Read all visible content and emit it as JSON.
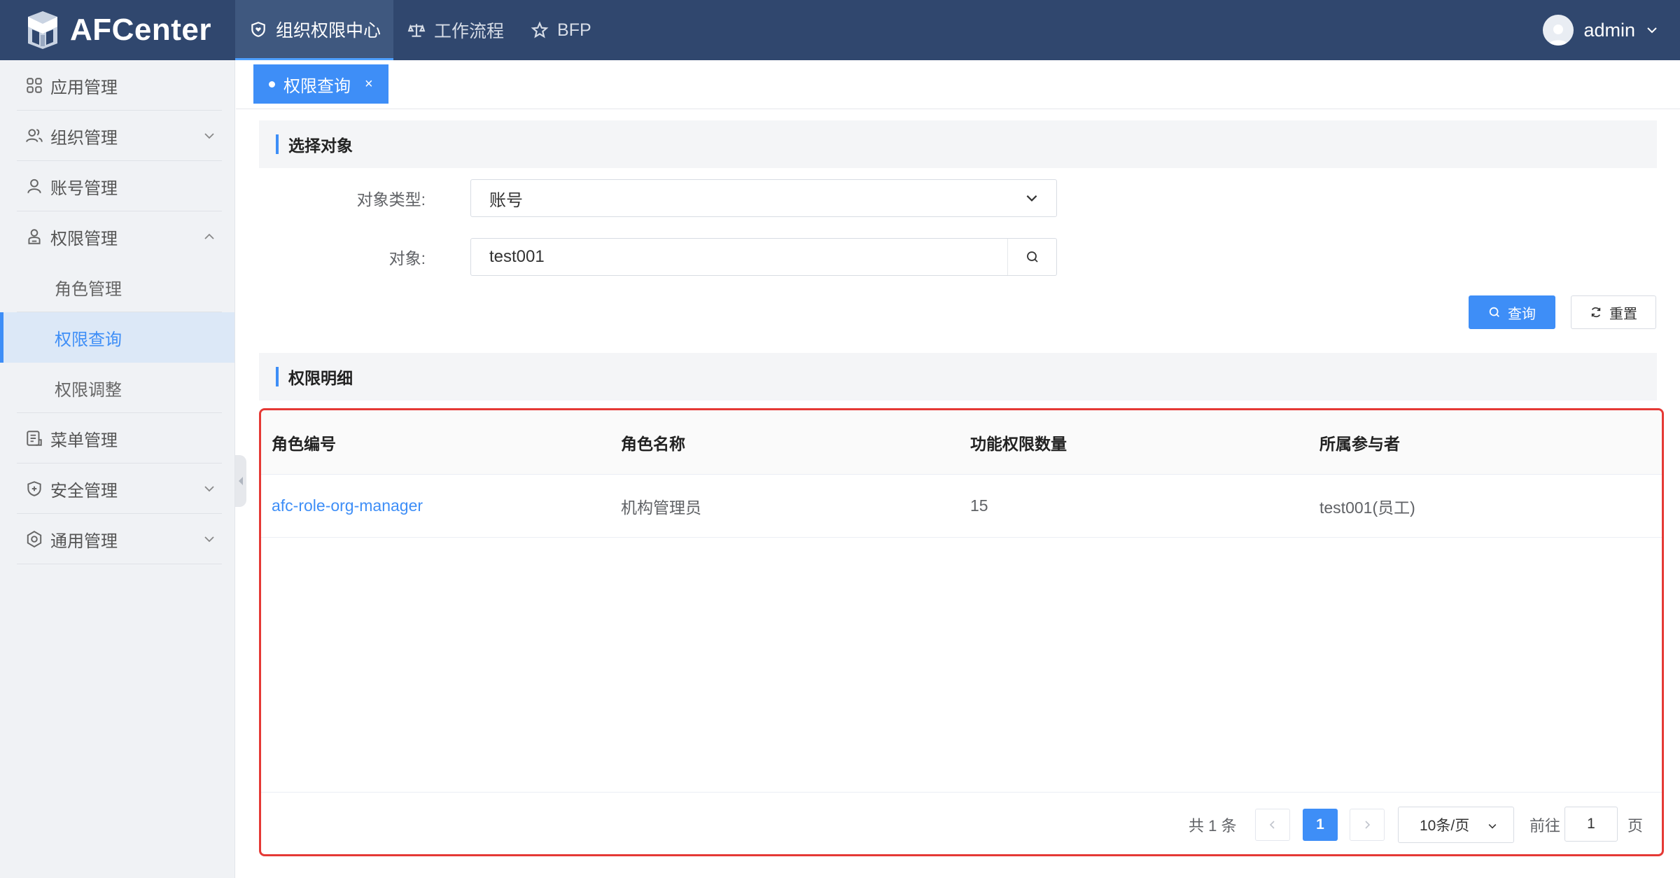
{
  "app": {
    "name": "AFCenter"
  },
  "topnav": [
    {
      "label": "组织权限中心",
      "icon": "shield-heart-icon",
      "active": true
    },
    {
      "label": "工作流程",
      "icon": "scale-icon",
      "active": false
    },
    {
      "label": "BFP",
      "icon": "star-icon",
      "active": false
    }
  ],
  "user": {
    "name": "admin"
  },
  "sidebar": {
    "items": [
      {
        "label": "应用管理",
        "icon": "grid-icon"
      },
      {
        "label": "组织管理",
        "icon": "users-icon",
        "expandable": true
      },
      {
        "label": "账号管理",
        "icon": "user-icon"
      },
      {
        "label": "权限管理",
        "icon": "lock-user-icon",
        "expanded": true,
        "children": [
          {
            "label": "角色管理"
          },
          {
            "label": "权限查询",
            "active": true
          },
          {
            "label": "权限调整"
          }
        ]
      },
      {
        "label": "菜单管理",
        "icon": "menu-doc-icon"
      },
      {
        "label": "安全管理",
        "icon": "shield-plus-icon",
        "expandable": true
      },
      {
        "label": "通用管理",
        "icon": "settings-icon",
        "expandable": true
      }
    ]
  },
  "tabs": [
    {
      "label": "权限查询",
      "close": "×"
    }
  ],
  "select_section": {
    "title": "选择对象",
    "type_label": "对象类型:",
    "type_value": "账号",
    "object_label": "对象:",
    "object_value": "test001",
    "query_button": "查询",
    "reset_button": "重置"
  },
  "detail_section": {
    "title": "权限明细",
    "columns": [
      "角色编号",
      "角色名称",
      "功能权限数量",
      "所属参与者"
    ],
    "rows": [
      [
        "afc-role-org-manager",
        "机构管理员",
        "15",
        "test001(员工)"
      ]
    ]
  },
  "pagination": {
    "total_text": "共 1 条",
    "current_page": "1",
    "page_size": "10条/页",
    "goto_label": "前往",
    "goto_value": "1",
    "page_suffix": "页"
  },
  "colors": {
    "primary": "#3e8ef7",
    "header_bg": "#30476e",
    "highlight_border": "#e53935"
  }
}
